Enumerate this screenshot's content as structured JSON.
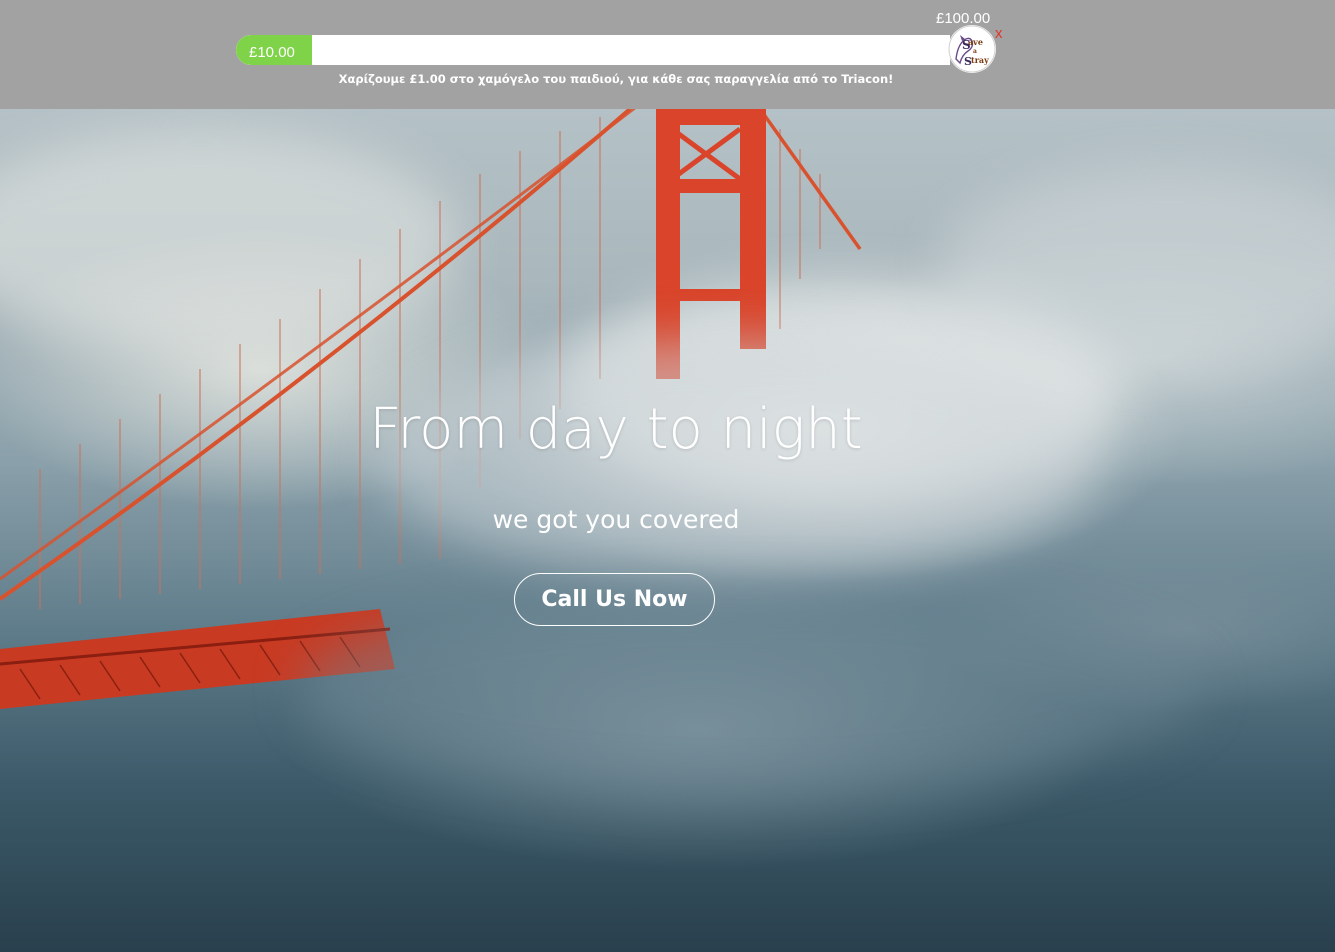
{
  "donation_bar": {
    "goal_amount": "£100.00",
    "current_amount": "£10.00",
    "progress_fraction": 0.1,
    "message": "Χαρίζουμε £1.00 στο χαμόγελο του παιδιού, για κάθε σας παραγγελία από το Triacon!",
    "close_label": "x",
    "logo_text": "Save a Stray",
    "colors": {
      "bar_bg": "#a2a2a2",
      "fill": "#7ed348",
      "close": "#e0362b"
    }
  },
  "hero": {
    "title": "From day to night",
    "subtitle": "we got you covered",
    "cta_label": "Call Us Now",
    "background_image": "golden-gate-bridge-in-fog"
  }
}
